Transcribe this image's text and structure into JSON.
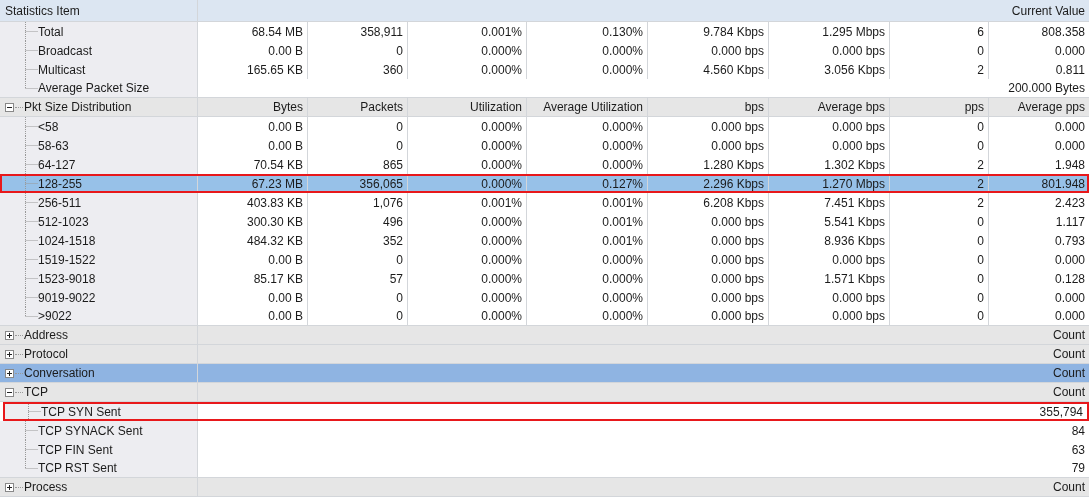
{
  "table": {
    "header": {
      "name": "Statistics Item",
      "value": "Current Value"
    },
    "sections": [
      {
        "children": [
          {
            "label": "Total",
            "cells": [
              "68.54 MB",
              "358,911",
              "0.001%",
              "0.130%",
              "9.784 Kbps",
              "1.295 Mbps",
              "6",
              "808.358"
            ],
            "selected": false,
            "outlined": false
          },
          {
            "label": "Broadcast",
            "cells": [
              "0.00 B",
              "0",
              "0.000%",
              "0.000%",
              "0.000 bps",
              "0.000 bps",
              "0",
              "0.000"
            ],
            "selected": false,
            "outlined": false
          },
          {
            "label": "Multicast",
            "cells": [
              "165.65 KB",
              "360",
              "0.000%",
              "0.000%",
              "4.560 Kbps",
              "3.056 Kbps",
              "2",
              "0.811"
            ],
            "selected": false,
            "outlined": false
          },
          {
            "label": "Average Packet Size",
            "value": "200.000 Bytes",
            "selected": false,
            "outlined": false
          }
        ]
      },
      {
        "label": "Pkt Size Distribution",
        "expanded": true,
        "selected": false,
        "columns": [
          "Bytes",
          "Packets",
          "Utilization",
          "Average Utilization",
          "bps",
          "Average bps",
          "pps",
          "Average pps"
        ],
        "children": [
          {
            "label": "<58",
            "cells": [
              "0.00 B",
              "0",
              "0.000%",
              "0.000%",
              "0.000 bps",
              "0.000 bps",
              "0",
              "0.000"
            ],
            "selected": false,
            "outlined": false
          },
          {
            "label": "58-63",
            "cells": [
              "0.00 B",
              "0",
              "0.000%",
              "0.000%",
              "0.000 bps",
              "0.000 bps",
              "0",
              "0.000"
            ],
            "selected": false,
            "outlined": false
          },
          {
            "label": "64-127",
            "cells": [
              "70.54 KB",
              "865",
              "0.000%",
              "0.000%",
              "1.280 Kbps",
              "1.302 Kbps",
              "2",
              "1.948"
            ],
            "selected": false,
            "outlined": false
          },
          {
            "label": "128-255",
            "cells": [
              "67.23 MB",
              "356,065",
              "0.000%",
              "0.127%",
              "2.296 Kbps",
              "1.270 Mbps",
              "2",
              "801.948"
            ],
            "selected": true,
            "outlined": true
          },
          {
            "label": "256-511",
            "cells": [
              "403.83 KB",
              "1,076",
              "0.001%",
              "0.001%",
              "6.208 Kbps",
              "7.451 Kbps",
              "2",
              "2.423"
            ],
            "selected": false,
            "outlined": false
          },
          {
            "label": "512-1023",
            "cells": [
              "300.30 KB",
              "496",
              "0.000%",
              "0.001%",
              "0.000 bps",
              "5.541 Kbps",
              "0",
              "1.117"
            ],
            "selected": false,
            "outlined": false
          },
          {
            "label": "1024-1518",
            "cells": [
              "484.32 KB",
              "352",
              "0.000%",
              "0.001%",
              "0.000 bps",
              "8.936 Kbps",
              "0",
              "0.793"
            ],
            "selected": false,
            "outlined": false
          },
          {
            "label": "1519-1522",
            "cells": [
              "0.00 B",
              "0",
              "0.000%",
              "0.000%",
              "0.000 bps",
              "0.000 bps",
              "0",
              "0.000"
            ],
            "selected": false,
            "outlined": false
          },
          {
            "label": "1523-9018",
            "cells": [
              "85.17 KB",
              "57",
              "0.000%",
              "0.000%",
              "0.000 bps",
              "1.571 Kbps",
              "0",
              "0.128"
            ],
            "selected": false,
            "outlined": false
          },
          {
            "label": "9019-9022",
            "cells": [
              "0.00 B",
              "0",
              "0.000%",
              "0.000%",
              "0.000 bps",
              "0.000 bps",
              "0",
              "0.000"
            ],
            "selected": false,
            "outlined": false
          },
          {
            "label": ">9022",
            "cells": [
              "0.00 B",
              "0",
              "0.000%",
              "0.000%",
              "0.000 bps",
              "0.000 bps",
              "0",
              "0.000"
            ],
            "selected": false,
            "outlined": false
          }
        ]
      },
      {
        "label": "Address",
        "expanded": false,
        "selected": false,
        "value": "Count"
      },
      {
        "label": "Protocol",
        "expanded": false,
        "selected": false,
        "value": "Count"
      },
      {
        "label": "Conversation",
        "expanded": false,
        "selected": true,
        "value": "Count"
      },
      {
        "label": "TCP",
        "expanded": true,
        "selected": false,
        "value": "Count",
        "children": [
          {
            "label": "TCP SYN Sent",
            "value": "355,794",
            "selected": false,
            "outlined": true
          },
          {
            "label": "TCP SYNACK Sent",
            "value": "84",
            "selected": false,
            "outlined": false
          },
          {
            "label": "TCP FIN Sent",
            "value": "63",
            "selected": false,
            "outlined": false
          },
          {
            "label": "TCP RST Sent",
            "value": "79",
            "selected": false,
            "outlined": false
          }
        ]
      },
      {
        "label": "Process",
        "expanded": false,
        "selected": false,
        "value": "Count"
      }
    ]
  }
}
